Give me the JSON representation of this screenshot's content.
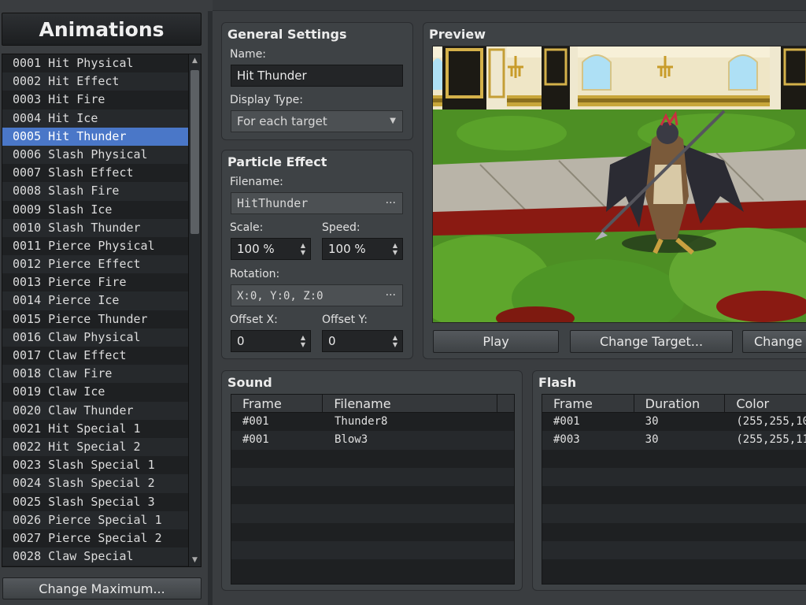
{
  "left": {
    "title": "Animations",
    "items": [
      "0001 Hit Physical",
      "0002 Hit Effect",
      "0003 Hit Fire",
      "0004 Hit Ice",
      "0005 Hit Thunder",
      "0006 Slash Physical",
      "0007 Slash Effect",
      "0008 Slash Fire",
      "0009 Slash Ice",
      "0010 Slash Thunder",
      "0011 Pierce Physical",
      "0012 Pierce Effect",
      "0013 Pierce Fire",
      "0014 Pierce Ice",
      "0015 Pierce Thunder",
      "0016 Claw Physical",
      "0017 Claw Effect",
      "0018 Claw Fire",
      "0019 Claw Ice",
      "0020 Claw Thunder",
      "0021 Hit Special 1",
      "0022 Hit Special 2",
      "0023 Slash Special 1",
      "0024 Slash Special 2",
      "0025 Slash Special 3",
      "0026 Pierce Special 1",
      "0027 Pierce Special 2",
      "0028 Claw Special"
    ],
    "selected_index": 4,
    "change_max_label": "Change Maximum..."
  },
  "general": {
    "title": "General Settings",
    "name_label": "Name:",
    "name_value": "Hit Thunder",
    "display_type_label": "Display Type:",
    "display_type_value": "For each target"
  },
  "particle": {
    "title": "Particle Effect",
    "filename_label": "Filename:",
    "filename_value": "HitThunder",
    "scale_label": "Scale:",
    "scale_value": "100 %",
    "speed_label": "Speed:",
    "speed_value": "100 %",
    "rotation_label": "Rotation:",
    "rotation_value": "X:0, Y:0, Z:0",
    "offset_x_label": "Offset X:",
    "offset_x_value": "0",
    "offset_y_label": "Offset Y:",
    "offset_y_value": "0",
    "ellipsis": "···"
  },
  "preview": {
    "title": "Preview",
    "play_label": "Play",
    "change_target_label": "Change Target...",
    "change_label": "Change"
  },
  "sound": {
    "title": "Sound",
    "columns": [
      "Frame",
      "Filename"
    ],
    "rows": [
      [
        "#001",
        "Thunder8"
      ],
      [
        "#001",
        "Blow3"
      ]
    ]
  },
  "flash": {
    "title": "Flash",
    "columns": [
      "Frame",
      "Duration",
      "Color"
    ],
    "rows": [
      [
        "#001",
        "30",
        "(255,255,10"
      ],
      [
        "#003",
        "30",
        "(255,255,11"
      ]
    ]
  },
  "colors": {
    "selection": "#4a77c8",
    "panel": "#3e4245",
    "list_bg": "#1e2022"
  }
}
